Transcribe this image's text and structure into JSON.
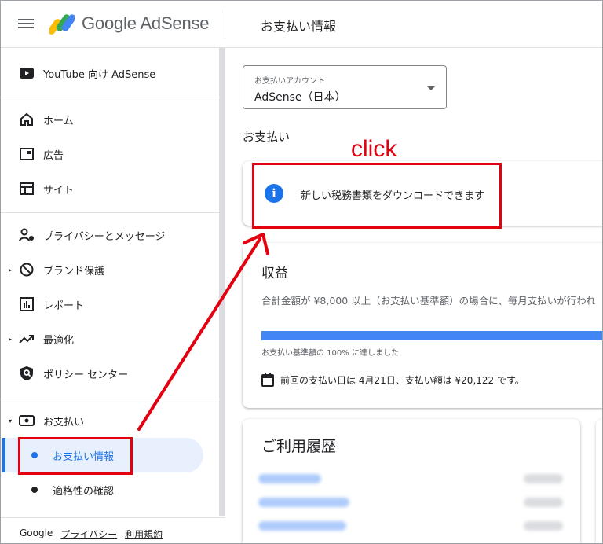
{
  "app": {
    "brand": "Google AdSense",
    "brand_google": "Google",
    "brand_product": "AdSense",
    "page_title": "お支払い情報"
  },
  "sidebar": {
    "items": [
      {
        "label": "YouTube 向け AdSense",
        "icon": "youtube-icon"
      },
      {
        "label": "ホーム",
        "icon": "home-icon"
      },
      {
        "label": "広告",
        "icon": "ads-icon"
      },
      {
        "label": "サイト",
        "icon": "sites-icon"
      },
      {
        "label": "プライバシーとメッセージ",
        "icon": "privacy-icon"
      },
      {
        "label": "ブランド保護",
        "icon": "block-icon"
      },
      {
        "label": "レポート",
        "icon": "report-icon"
      },
      {
        "label": "最適化",
        "icon": "trending-icon"
      },
      {
        "label": "ポリシー センター",
        "icon": "policy-shield-icon"
      },
      {
        "label": "お支払い",
        "icon": "payments-icon"
      }
    ],
    "sub_items": [
      {
        "label": "お支払い情報",
        "active": true
      },
      {
        "label": "適格性の確認",
        "active": false
      }
    ],
    "footer": {
      "google": "Google",
      "privacy": "プライバシー",
      "terms": "利用規約"
    }
  },
  "main": {
    "account_select": {
      "caption": "お支払いアカウント",
      "value": "AdSense（日本）"
    },
    "section_label": "お支払い",
    "notice": {
      "text": "新しい税務書類をダウンロードできます"
    },
    "earnings": {
      "title": "収益",
      "description": "合計金額が ¥8,000 以上（お支払い基準額）の場合に、毎月支払いが行われ",
      "progress_percent": 100,
      "progress_caption": "お支払い基準額の 100% に達しました",
      "last_payment": "前回の支払い日は 4月21日、支払い額は ¥20,122 です。"
    },
    "history": {
      "title": "ご利用履歴"
    }
  },
  "annotation": {
    "click_label": "click"
  },
  "colors": {
    "accent": "#1a73e8",
    "annotation": "#e3000f",
    "progress": "#4285f4"
  }
}
